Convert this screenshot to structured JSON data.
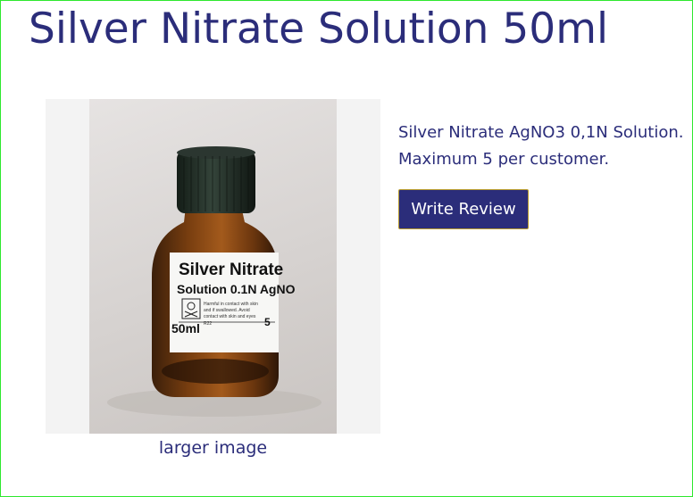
{
  "page": {
    "title": "Silver Nitrate Solution 50ml",
    "larger_image_label": "larger image"
  },
  "product": {
    "description": "Silver Nitrate AgNO3 0,1N Solution. Maximum 5 per customer.",
    "review_button_label": "Write Review"
  },
  "bottle_label": {
    "line1": "Silver Nitrate",
    "line2": "Solution 0.1N AgNO",
    "warning_1": "Harmful in contact with skin",
    "warning_2": "and if swallowed. Avoid",
    "warning_3": "contact with skin and eyes",
    "code": "R22",
    "volume": "50ml",
    "side_mark": "5"
  },
  "colors": {
    "text": "#2b2d7a",
    "button_bg": "#2b2d7a",
    "button_border": "#b89b2e",
    "frame_border": "#2ee82e"
  }
}
